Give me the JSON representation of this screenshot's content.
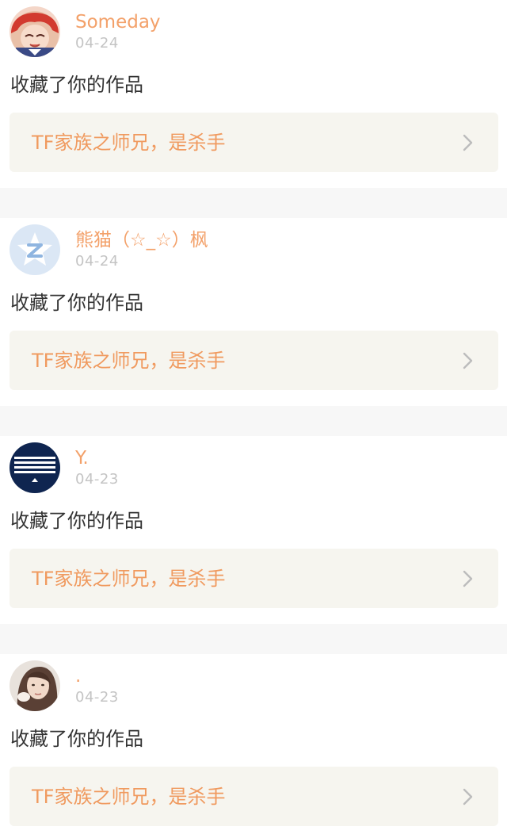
{
  "notifications": [
    {
      "username": "Someday",
      "date": "04-24",
      "action": "收藏了你的作品",
      "work_title": "TF家族之师兄，是杀手",
      "avatar_icon": "anime-avatar"
    },
    {
      "username": "熊猫（☆_☆）枫",
      "date": "04-24",
      "action": "收藏了你的作品",
      "work_title": "TF家族之师兄，是杀手",
      "avatar_icon": "default-z-avatar"
    },
    {
      "username": "Y.",
      "date": "04-23",
      "action": "收藏了你的作品",
      "work_title": "TF家族之师兄，是杀手",
      "avatar_icon": "navy-stripes-avatar"
    },
    {
      "username": ".",
      "date": "04-23",
      "action": "收藏了你的作品",
      "work_title": "TF家族之师兄，是杀手",
      "avatar_icon": "photo-avatar"
    }
  ],
  "colors": {
    "username": "#f3a16a",
    "date": "#c4c4c4",
    "action_text": "#333333",
    "work_title": "#f09a5f",
    "work_link_bg": "#f6f5ef",
    "separator": "#f7f7f7"
  }
}
